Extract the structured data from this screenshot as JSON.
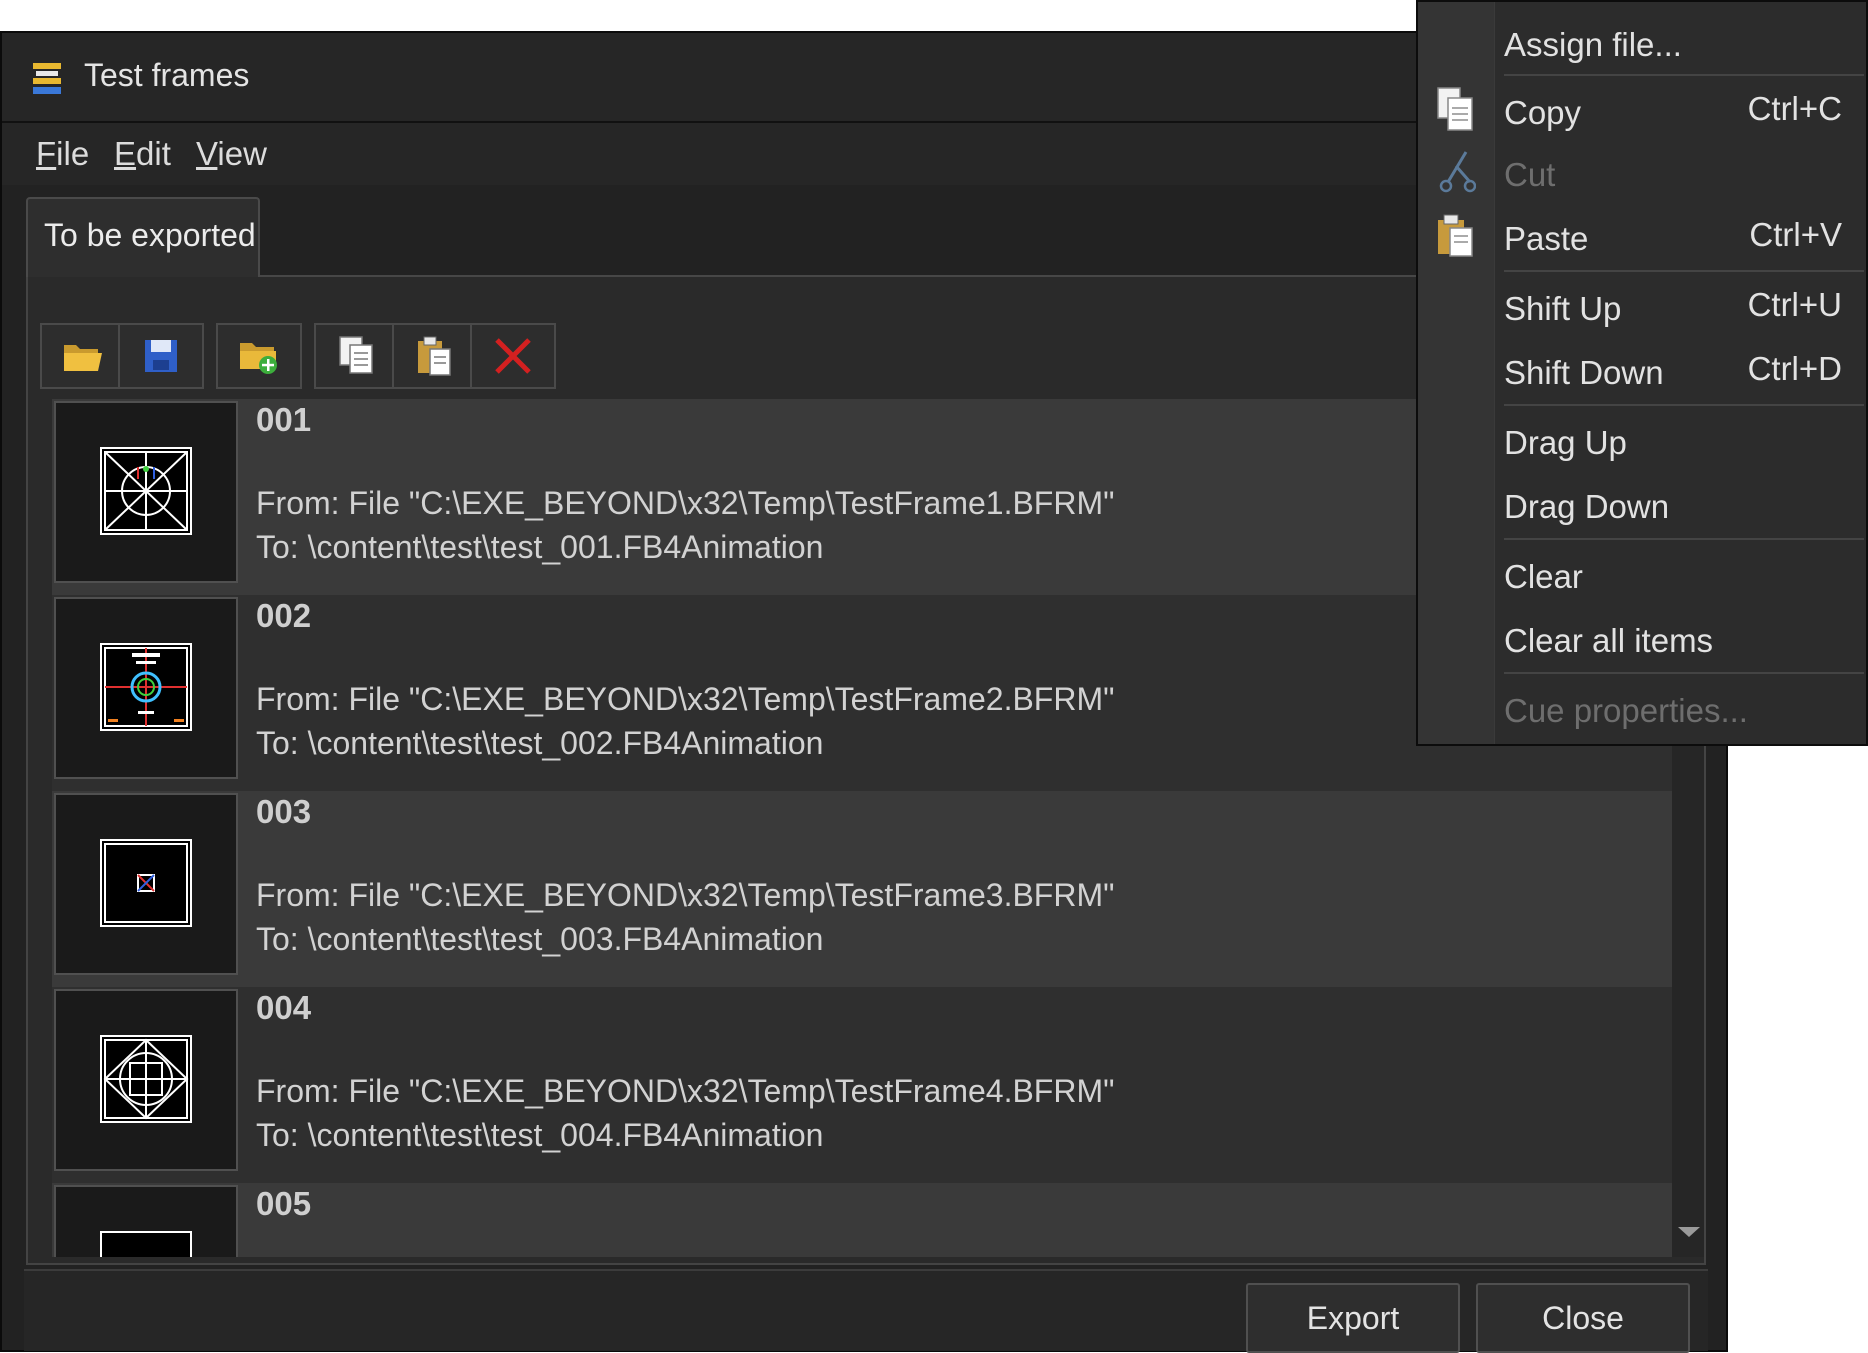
{
  "window": {
    "title": "Test frames"
  },
  "menubar": {
    "items": [
      {
        "mnemonic": "F",
        "rest": "ile"
      },
      {
        "mnemonic": "E",
        "rest": "dit"
      },
      {
        "mnemonic": "V",
        "rest": "iew"
      }
    ]
  },
  "tab": {
    "label": "To be exported"
  },
  "toolbar": {
    "icons": [
      "open-folder-icon",
      "save-icon",
      "add-folder-icon",
      "copy-icon",
      "paste-icon",
      "delete-icon"
    ]
  },
  "items": [
    {
      "number": "001",
      "from": "From: File \"C:\\EXE_BEYOND\\x32\\Temp\\TestFrame1.BFRM\"",
      "to": "To: \\content\\test\\test_001.FB4Animation"
    },
    {
      "number": "002",
      "from": "From: File \"C:\\EXE_BEYOND\\x32\\Temp\\TestFrame2.BFRM\"",
      "to": "To: \\content\\test\\test_002.FB4Animation"
    },
    {
      "number": "003",
      "from": "From: File \"C:\\EXE_BEYOND\\x32\\Temp\\TestFrame3.BFRM\"",
      "to": "To: \\content\\test\\test_003.FB4Animation"
    },
    {
      "number": "004",
      "from": "From: File \"C:\\EXE_BEYOND\\x32\\Temp\\TestFrame4.BFRM\"",
      "to": "To: \\content\\test\\test_004.FB4Animation"
    },
    {
      "number": "005",
      "from": "",
      "to": ""
    }
  ],
  "footer": {
    "export_label": "Export",
    "close_label": "Close"
  },
  "context_menu": {
    "items": [
      {
        "label": "Assign file...",
        "shortcut": "",
        "enabled": true
      },
      {
        "label": "Copy",
        "shortcut": "Ctrl+C",
        "enabled": true
      },
      {
        "label": "Cut",
        "shortcut": "",
        "enabled": false
      },
      {
        "label": "Paste",
        "shortcut": "Ctrl+V",
        "enabled": true
      },
      {
        "label": "Shift Up",
        "shortcut": "Ctrl+U",
        "enabled": true
      },
      {
        "label": "Shift Down",
        "shortcut": "Ctrl+D",
        "enabled": true
      },
      {
        "label": "Drag Up",
        "shortcut": "",
        "enabled": true
      },
      {
        "label": "Drag Down",
        "shortcut": "",
        "enabled": true
      },
      {
        "label": "Clear",
        "shortcut": "",
        "enabled": true
      },
      {
        "label": "Clear all items",
        "shortcut": "",
        "enabled": true
      },
      {
        "label": "Cue properties...",
        "shortcut": "",
        "enabled": false
      }
    ]
  },
  "colors": {
    "background": "#222222",
    "row_light": "#3a3a3a",
    "row_dark": "#2f2f2f",
    "delete_red": "#d42020"
  }
}
